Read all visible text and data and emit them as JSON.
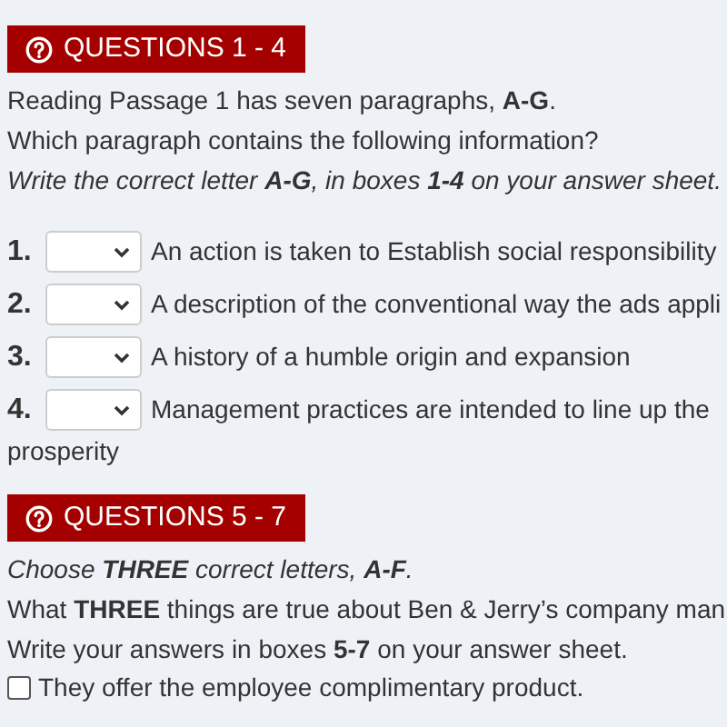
{
  "sections": [
    {
      "heading": "QUESTIONS 1 - 4",
      "instructions": [
        {
          "text": "Reading Passage 1 has seven paragraphs, **A-G**.",
          "italic": false
        },
        {
          "text": "Which paragraph contains the following information?",
          "italic": false
        },
        {
          "text": "Write the correct letter **A-G**, in boxes **1-4** on your answer sheet.",
          "italic": true
        }
      ],
      "questions": [
        {
          "kind": "select",
          "number": "1.",
          "text": "An action is taken to Establish social responsibility"
        },
        {
          "kind": "select",
          "number": "2.",
          "text": "A description of the conventional way the ads appli"
        },
        {
          "kind": "select",
          "number": "3.",
          "text": "A history of a humble origin and expansion"
        },
        {
          "kind": "select",
          "number": "4.",
          "text": "Management practices are intended to line up the",
          "continuation": "prosperity"
        }
      ]
    },
    {
      "heading": "QUESTIONS 5 - 7",
      "instructions": [
        {
          "text": "Choose **THREE** correct letters, **A-F**.",
          "italic": true
        },
        {
          "text": "What **THREE** things are true about Ben & Jerry’s company man",
          "italic": false
        },
        {
          "text": "Write your answers in boxes **5-7** on your answer sheet.",
          "italic": false
        }
      ],
      "questions": [
        {
          "kind": "checkbox",
          "text": "They offer the employee complimentary product.",
          "checked": false
        }
      ]
    }
  ]
}
